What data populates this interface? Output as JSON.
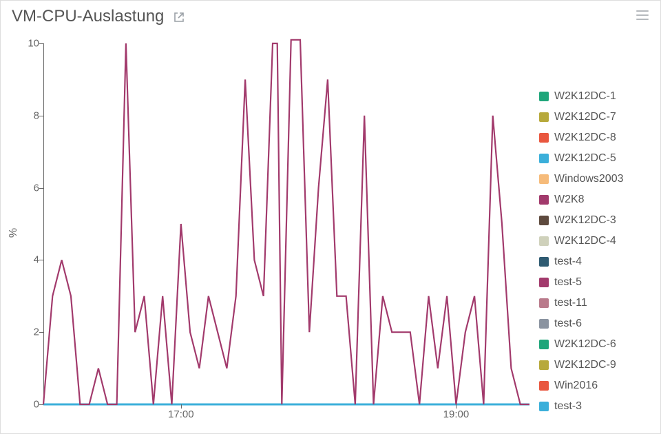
{
  "header": {
    "title": "VM-CPU-Auslastung"
  },
  "chart_data": {
    "type": "line",
    "title": "VM-CPU-Auslastung",
    "ylabel": "%",
    "xlabel": "",
    "ylim": [
      0,
      10
    ],
    "y_ticks": [
      0,
      2,
      4,
      6,
      8,
      10
    ],
    "x_range_minutes": [
      960,
      1172
    ],
    "x_tick_minutes": [
      1020,
      1140
    ],
    "x_tick_labels": [
      "17:00",
      "19:00"
    ],
    "series": [
      {
        "name": "W2K12DC-1",
        "color": "#1FA67A",
        "flat_value": 0
      },
      {
        "name": "W2K12DC-7",
        "color": "#B7A93B",
        "flat_value": 0
      },
      {
        "name": "W2K12DC-8",
        "color": "#E9573F",
        "flat_value": 0
      },
      {
        "name": "W2K12DC-5",
        "color": "#3BAFDA",
        "flat_value": 0
      },
      {
        "name": "Windows2003",
        "color": "#F6BB7A",
        "flat_value": 0
      },
      {
        "name": "W2K8",
        "color": "#A23A6C",
        "x_minutes": [
          960,
          964,
          968,
          972,
          976,
          980,
          984,
          988,
          992,
          996,
          1000,
          1004,
          1008,
          1012,
          1016,
          1020,
          1024,
          1028,
          1032,
          1036,
          1040,
          1044,
          1048,
          1052,
          1056,
          1060,
          1062,
          1064,
          1068,
          1072,
          1076,
          1080,
          1084,
          1088,
          1092,
          1096,
          1100,
          1104,
          1108,
          1112,
          1116,
          1120,
          1124,
          1128,
          1132,
          1136,
          1140,
          1144,
          1148,
          1152,
          1156,
          1160,
          1164,
          1168,
          1172
        ],
        "values": [
          0,
          3,
          4,
          3,
          0,
          0,
          1,
          0,
          0,
          10,
          2,
          3,
          0,
          3,
          0,
          5,
          2,
          1,
          3,
          2,
          1,
          3,
          9,
          4,
          3,
          10,
          10,
          0,
          10.1,
          10.1,
          2,
          6,
          9,
          3,
          3,
          0,
          8,
          0,
          3,
          2,
          2,
          2,
          0,
          3,
          1,
          3,
          0,
          2,
          3,
          0,
          8,
          5,
          1,
          0,
          0
        ]
      },
      {
        "name": "W2K12DC-3",
        "color": "#5E4A3E",
        "flat_value": 0
      },
      {
        "name": "W2K12DC-4",
        "color": "#CFD1BB",
        "flat_value": 0
      },
      {
        "name": "test-4",
        "color": "#2F5B72",
        "flat_value": 0
      },
      {
        "name": "test-5",
        "color": "#A23A6C",
        "flat_value": 0
      },
      {
        "name": "test-11",
        "color": "#B97A8B",
        "flat_value": 0
      },
      {
        "name": "test-6",
        "color": "#8A93A0",
        "flat_value": 0
      },
      {
        "name": "W2K12DC-6",
        "color": "#1FA67A",
        "flat_value": 0
      },
      {
        "name": "W2K12DC-9",
        "color": "#B7A93B",
        "flat_value": 0
      },
      {
        "name": "Win2016",
        "color": "#E9573F",
        "flat_value": 0
      },
      {
        "name": "test-3",
        "color": "#3BAFDA",
        "flat_value": 0
      }
    ]
  }
}
